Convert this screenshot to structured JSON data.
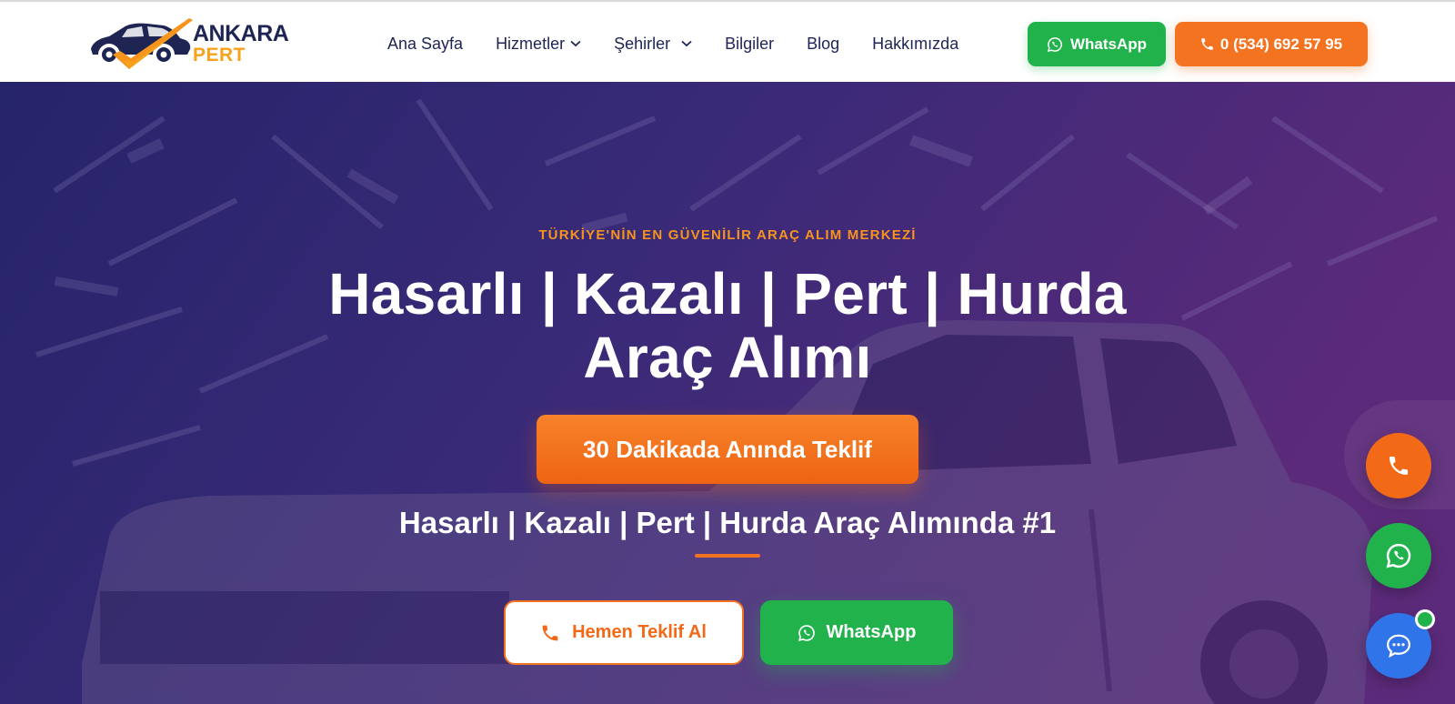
{
  "brand": {
    "name_top": "ANKARA",
    "name_bottom": "PERT",
    "colors": {
      "navy": "#1e2552",
      "orange": "#f47320",
      "yellow": "#f7a21b",
      "green": "#22b24c",
      "blue": "#2f74e8"
    }
  },
  "nav": {
    "items": [
      {
        "label": "Ana Sayfa",
        "has_dropdown": false
      },
      {
        "label": "Hizmetler",
        "has_dropdown": true
      },
      {
        "label": "Şehirler",
        "has_dropdown": true
      },
      {
        "label": "Bilgiler",
        "has_dropdown": false
      },
      {
        "label": "Blog",
        "has_dropdown": false
      },
      {
        "label": "Hakkımızda",
        "has_dropdown": false
      }
    ]
  },
  "header_actions": {
    "whatsapp_label": "WhatsApp",
    "phone_label": "0 (534) 692 57 95"
  },
  "hero": {
    "kicker": "TÜRKİYE'NİN EN GÜVENİLİR ARAÇ ALIM MERKEZİ",
    "title_line1": "Hasarlı | Kazalı | Pert | Hurda",
    "title_line2": "Araç Alımı",
    "offer_button": "30 Dakikada Anında Teklif",
    "subtitle": "Hasarlı | Kazalı | Pert | Hurda Araç Alımında #1",
    "call_button": "Hemen Teklif Al",
    "whatsapp_button": "WhatsApp"
  },
  "floating": {
    "icons": [
      "phone-icon",
      "whatsapp-icon",
      "chat-icon"
    ]
  }
}
